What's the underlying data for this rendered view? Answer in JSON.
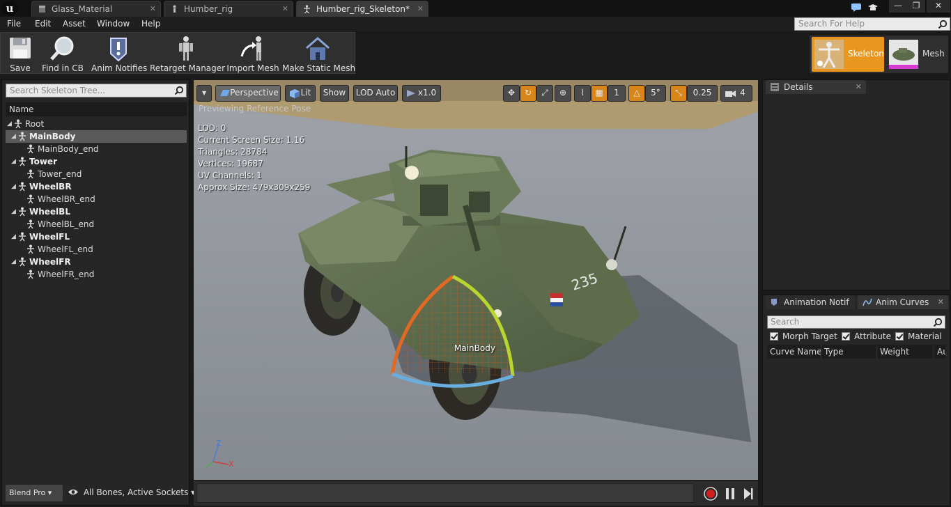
{
  "tabs": [
    {
      "label": "Glass_Material",
      "icon": "material-icon"
    },
    {
      "label": "Humber_rig",
      "icon": "mesh-icon"
    },
    {
      "label": "Humber_rig_Skeleton*",
      "icon": "skeleton-icon"
    }
  ],
  "menu": [
    "File",
    "Edit",
    "Asset",
    "Window",
    "Help"
  ],
  "help_search": {
    "placeholder": "Search For Help"
  },
  "toolbar": {
    "save": "Save",
    "find_in_cb": "Find in CB",
    "anim_notifies": "Anim Notifies",
    "retarget_manager": "Retarget Manager",
    "import_mesh": "Import Mesh",
    "make_static_mesh": "Make Static Mesh"
  },
  "modes": {
    "skeleton": "Skeleton",
    "mesh": "Mesh",
    "active": "Skeleton"
  },
  "skeleton_tree": {
    "search_placeholder": "Search Skeleton Tree...",
    "column": "Name",
    "rows": [
      {
        "label": "Root",
        "depth": 0,
        "bold": false,
        "expander": true,
        "selected": false
      },
      {
        "label": "MainBody",
        "depth": 1,
        "bold": true,
        "expander": true,
        "selected": true
      },
      {
        "label": "MainBody_end",
        "depth": 2,
        "bold": false,
        "expander": false,
        "selected": false
      },
      {
        "label": "Tower",
        "depth": 1,
        "bold": true,
        "expander": true,
        "selected": false
      },
      {
        "label": "Tower_end",
        "depth": 2,
        "bold": false,
        "expander": false,
        "selected": false
      },
      {
        "label": "WheelBR",
        "depth": 1,
        "bold": true,
        "expander": true,
        "selected": false
      },
      {
        "label": "WheelBR_end",
        "depth": 2,
        "bold": false,
        "expander": false,
        "selected": false
      },
      {
        "label": "WheelBL",
        "depth": 1,
        "bold": true,
        "expander": true,
        "selected": false
      },
      {
        "label": "WheelBL_end",
        "depth": 2,
        "bold": false,
        "expander": false,
        "selected": false
      },
      {
        "label": "WheelFL",
        "depth": 1,
        "bold": true,
        "expander": true,
        "selected": false
      },
      {
        "label": "WheelFL_end",
        "depth": 2,
        "bold": false,
        "expander": false,
        "selected": false
      },
      {
        "label": "WheelFR",
        "depth": 1,
        "bold": true,
        "expander": true,
        "selected": false
      },
      {
        "label": "WheelFR_end",
        "depth": 2,
        "bold": false,
        "expander": false,
        "selected": false
      }
    ],
    "blend_profile": "Blend Pro",
    "bones_filter": "All Bones, Active Sockets"
  },
  "viewport": {
    "perspective": "Perspective",
    "lit": "Lit",
    "show": "Show",
    "lod": "LOD Auto",
    "speed": "x1.0",
    "grid_value": "1",
    "angle_snap": "5°",
    "scale_snap": "0.25",
    "camera_speed": "4",
    "preview_mode": "Previewing Reference Pose",
    "stats": [
      "LOD: 0",
      "Current Screen Size: 1.16",
      "Triangles: 28784",
      "Vertices: 19687",
      "UV Channels: 1",
      "Approx Size: 479x309x259"
    ],
    "bone_label": "MainBody",
    "vehicle_number": "235",
    "axis": {
      "z": "Z",
      "x": "X"
    }
  },
  "details": {
    "tab": "Details"
  },
  "curves": {
    "tab_notifies": "Animation Notif",
    "tab_curves": "Anim Curves",
    "search_placeholder": "Search",
    "filters": [
      {
        "label": "Morph Target",
        "checked": true
      },
      {
        "label": "Attribute",
        "checked": true
      },
      {
        "label": "Material",
        "checked": true
      }
    ],
    "columns": [
      "Curve Name",
      "Type",
      "Weight",
      "Au"
    ]
  },
  "colors": {
    "accent": "#e8961e",
    "panel": "#262626"
  }
}
